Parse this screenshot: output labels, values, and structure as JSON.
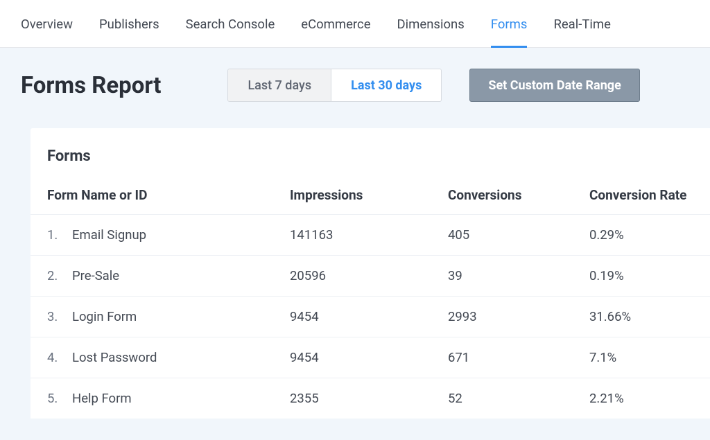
{
  "tabs": [
    {
      "label": "Overview"
    },
    {
      "label": "Publishers"
    },
    {
      "label": "Search Console"
    },
    {
      "label": "eCommerce"
    },
    {
      "label": "Dimensions"
    },
    {
      "label": "Forms",
      "active": true
    },
    {
      "label": "Real-Time"
    }
  ],
  "pageTitle": "Forms Report",
  "range": {
    "last7": "Last 7 days",
    "last30": "Last 30 days",
    "customLabel": "Set Custom Date Range"
  },
  "cardTitle": "Forms",
  "columns": {
    "name": "Form Name or ID",
    "impressions": "Impressions",
    "conversions": "Conversions",
    "rate": "Conversion Rate"
  },
  "rows": [
    {
      "num": "1.",
      "name": "Email Signup",
      "impressions": "141163",
      "conversions": "405",
      "rate": "0.29%"
    },
    {
      "num": "2.",
      "name": "Pre-Sale",
      "impressions": "20596",
      "conversions": "39",
      "rate": "0.19%"
    },
    {
      "num": "3.",
      "name": "Login Form",
      "impressions": "9454",
      "conversions": "2993",
      "rate": "31.66%"
    },
    {
      "num": "4.",
      "name": "Lost Password",
      "impressions": "9454",
      "conversions": "671",
      "rate": "7.1%"
    },
    {
      "num": "5.",
      "name": "Help Form",
      "impressions": "2355",
      "conversions": "52",
      "rate": "2.21%"
    }
  ]
}
